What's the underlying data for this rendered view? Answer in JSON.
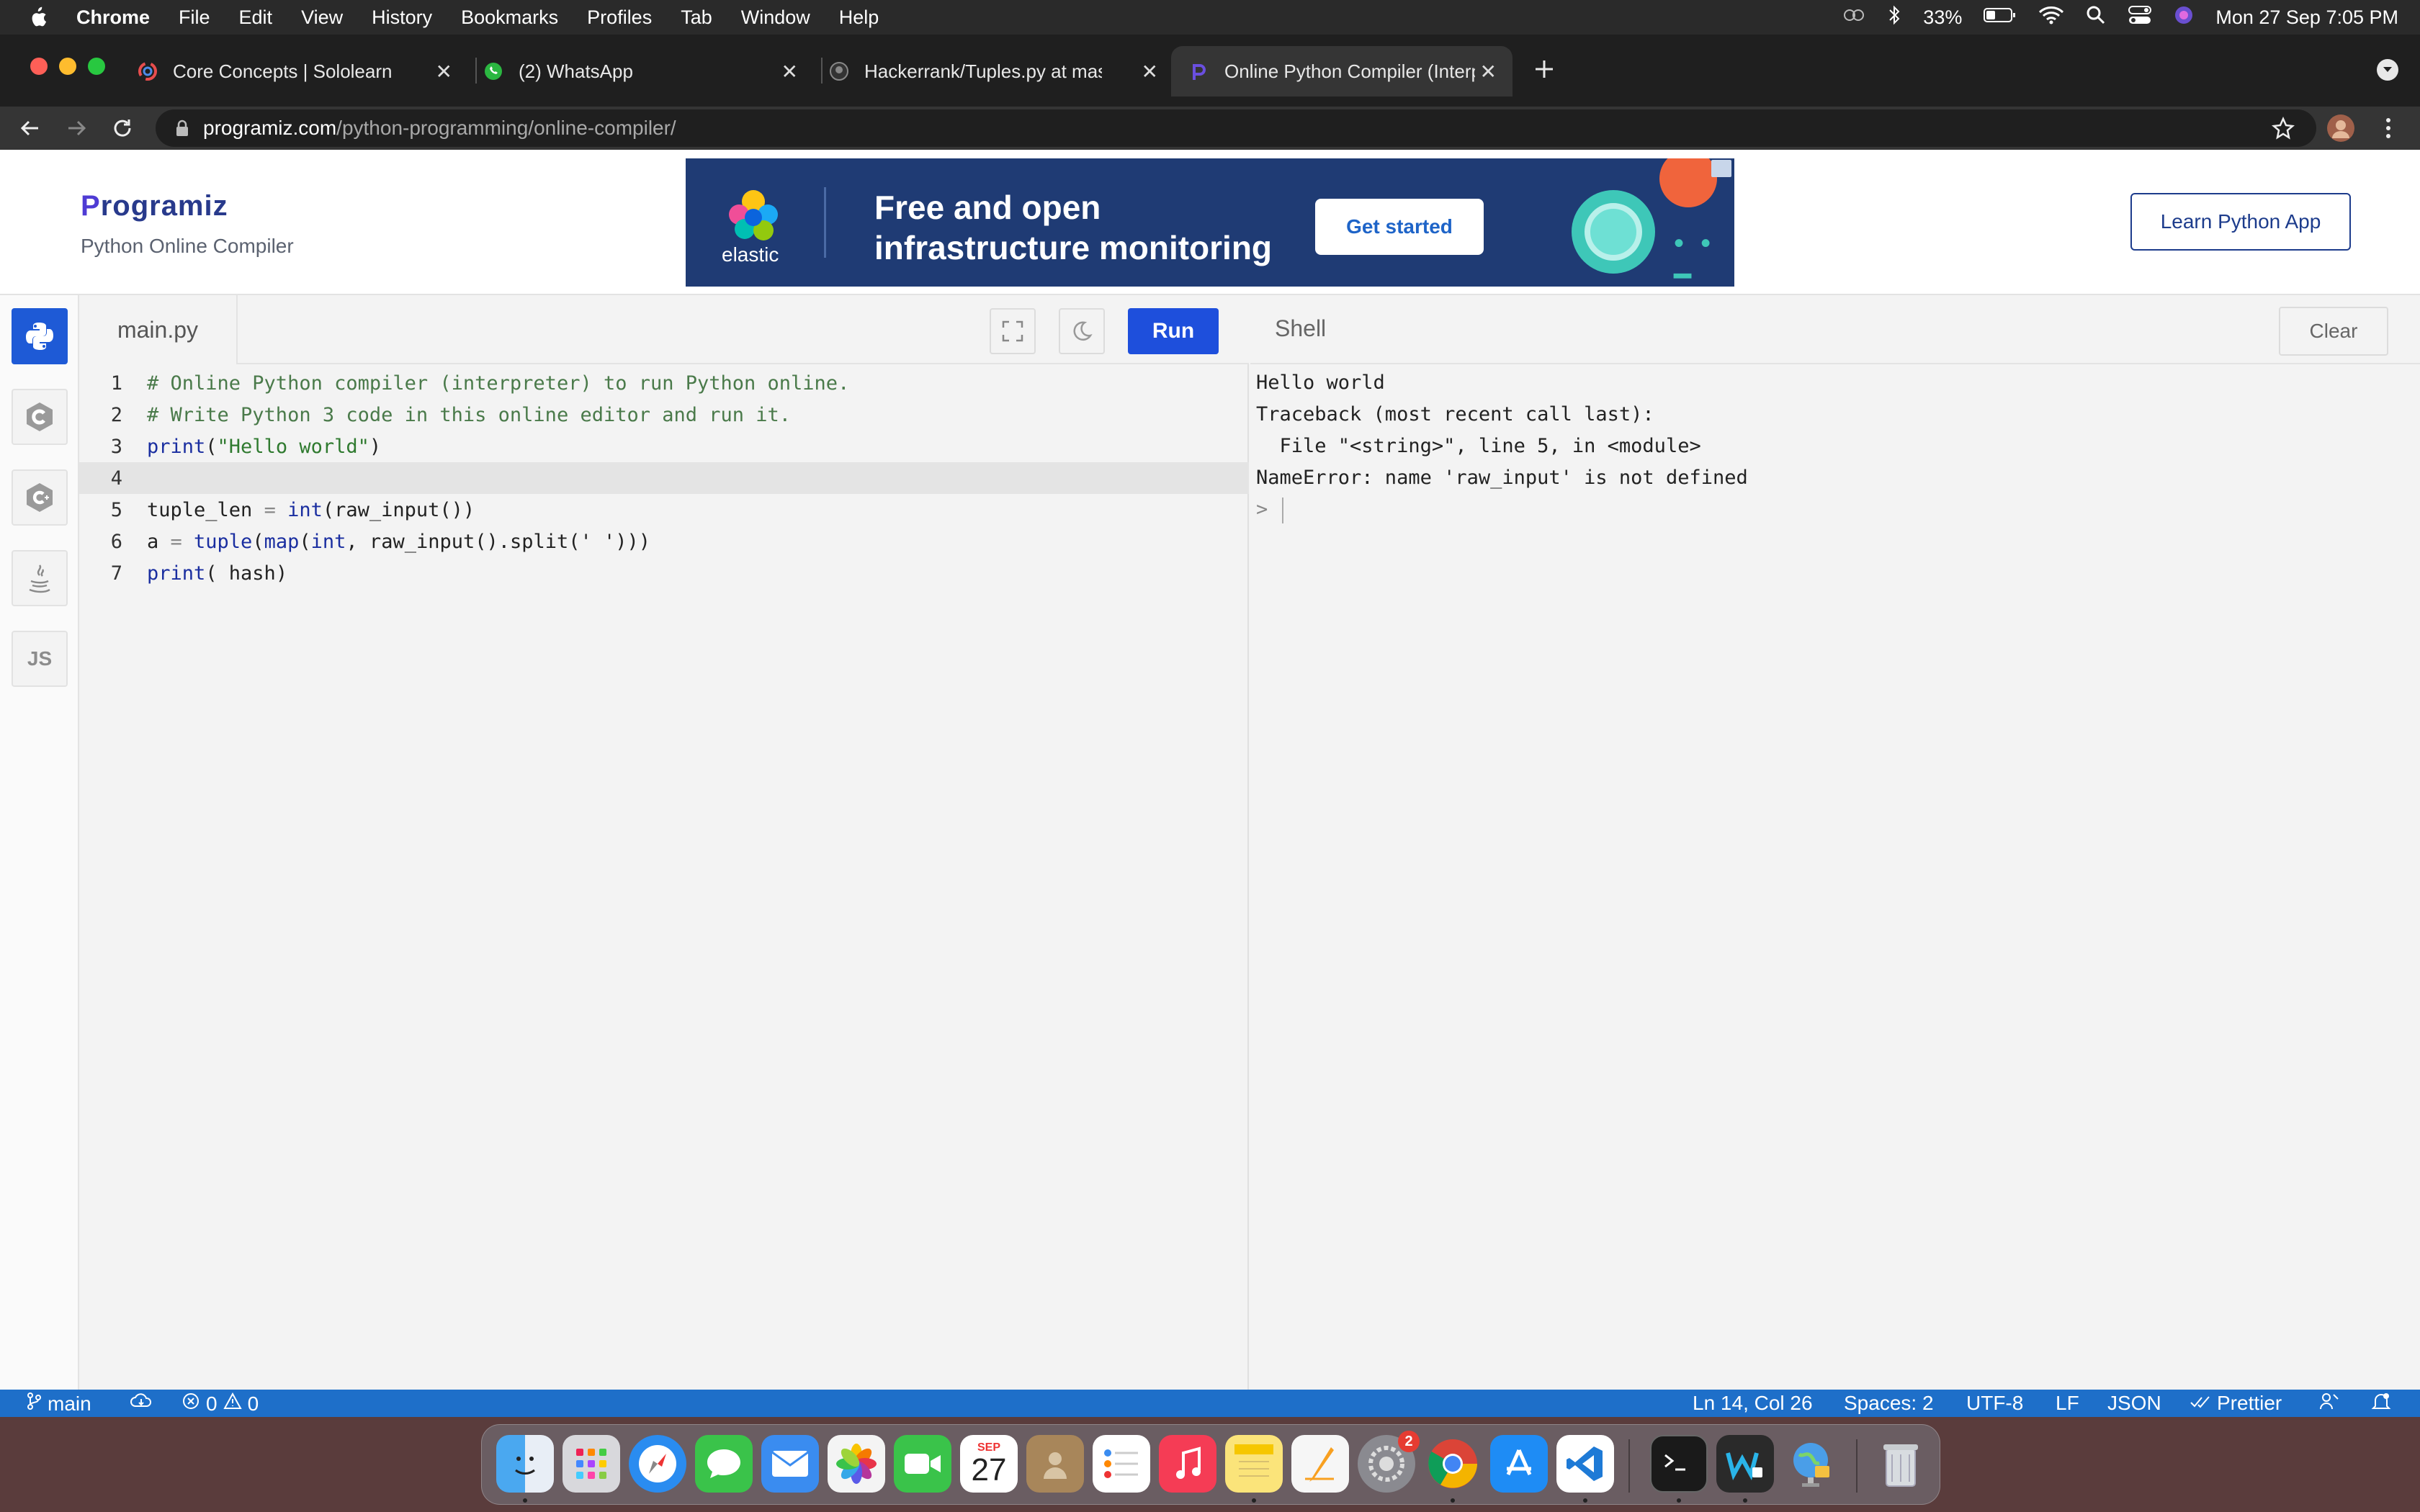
{
  "menubar": {
    "app_name": "Chrome",
    "items": [
      "File",
      "Edit",
      "View",
      "History",
      "Bookmarks",
      "Profiles",
      "Tab",
      "Window",
      "Help"
    ],
    "battery": "33%",
    "datetime": "Mon 27 Sep  7:05 PM"
  },
  "tabs": [
    {
      "title": "Core Concepts | Sololearn",
      "icon": "sololearn-icon"
    },
    {
      "title": "(2) WhatsApp",
      "icon": "whatsapp-icon"
    },
    {
      "title": "Hackerrank/Tuples.py at maste",
      "icon": "github-icon"
    },
    {
      "title": "Online Python Compiler (Interp",
      "icon": "programiz-icon",
      "active": true
    }
  ],
  "address": {
    "host": "programiz.com",
    "path": "/python-programming/online-compiler/"
  },
  "header": {
    "logo": "rogramiz",
    "logo_initial": "P",
    "subtitle": "Python Online Compiler",
    "learn_button": "Learn Python App"
  },
  "ad": {
    "brand": "elastic",
    "headline": "Free and open infrastructure monitoring",
    "cta": "Get started"
  },
  "languages": [
    {
      "name": "python-lang-icon",
      "label": ""
    },
    {
      "name": "c-lang-icon",
      "label": ""
    },
    {
      "name": "cpp-lang-icon",
      "label": ""
    },
    {
      "name": "java-lang-icon",
      "label": ""
    },
    {
      "name": "js-lang-icon",
      "label": "JS"
    }
  ],
  "editor": {
    "filename": "main.py",
    "run_label": "Run",
    "line_numbers": [
      "1",
      "2",
      "3",
      "4",
      "5",
      "6",
      "7"
    ],
    "lines": {
      "l1": "# Online Python compiler (interpreter) to run Python online.",
      "l2": "# Write Python 3 code in this online editor and run it.",
      "l3_kw": "print",
      "l3_open": "(",
      "l3_str": "\"Hello world\"",
      "l3_close": ")",
      "l5_a": "tuple_len ",
      "l5_op": "=",
      "l5_kw": " int",
      "l5_b": "(raw_input())",
      "l6_a": "a ",
      "l6_op": "=",
      "l6_kw1": " tuple",
      "l6_b": "(",
      "l6_kw2": "map",
      "l6_c": "(",
      "l6_kw3": "int",
      "l6_d": ", raw_input().split(' ')))",
      "l7_kw": "print",
      "l7_b": "( hash)"
    }
  },
  "shell": {
    "title": "Shell",
    "clear_label": "Clear",
    "output": [
      "Hello world",
      "Traceback (most recent call last):",
      "  File \"<string>\", line 5, in <module>",
      "NameError: name 'raw_input' is not defined"
    ],
    "prompt": ">"
  },
  "statusbar": {
    "branch": "main",
    "errors": "0",
    "warnings": "0",
    "position": "Ln 14, Col 26",
    "spaces": "Spaces: 2",
    "encoding": "UTF-8",
    "eol": "LF",
    "language": "JSON",
    "formatter": "Prettier"
  },
  "dock": {
    "calendar_month": "SEP",
    "calendar_day": "27",
    "settings_badge": "2"
  },
  "colors": {
    "accent": "#1e4fdc",
    "statusbar": "#1e6fc9",
    "ad_bg": "#1f3b74"
  }
}
